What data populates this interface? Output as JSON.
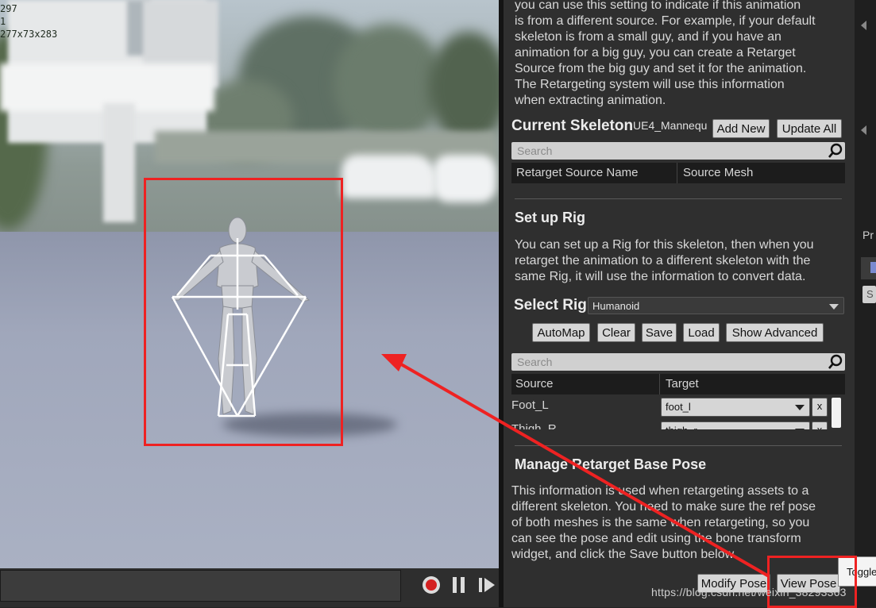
{
  "viewport": {
    "stats": [
      "297",
      "1",
      "277x73x283"
    ]
  },
  "panel": {
    "retarget_source_desc": "you can use this setting to indicate if this animation is from a different source. For example, if your default skeleton is from a small guy, and if you have an animation for a big guy, you can create a Retarget Source from the big guy and set it for the animation. The Retargeting system will use this information when extracting animation.",
    "retarget_source_lines": [
      "you can use this setting to indicate if this animation",
      "is from a different source. For example, if your default",
      "skeleton is from a small guy, and if you have an",
      "animation for a big guy, you can create a Retarget",
      "Source from the big guy and set it for the animation.",
      "The Retargeting system will use this information",
      "when extracting animation."
    ],
    "current_skeleton_label": "Current Skeleton",
    "current_skeleton_value": "UE4_Mannequ",
    "add_new_label": "Add New",
    "update_all_label": "Update All",
    "search_placeholder": "Search",
    "retarget_table_headers": [
      "Retarget Source Name",
      "Source Mesh"
    ],
    "setup_rig_title": "Set up Rig",
    "setup_rig_lines": [
      "You can set up a Rig for this skeleton, then when you",
      "retarget the animation to a different skeleton with the",
      "same Rig, it will use the information to convert data."
    ],
    "select_rig_label": "Select Rig",
    "select_rig_value": "Humanoid",
    "rig_buttons": [
      "AutoMap",
      "Clear",
      "Save",
      "Load",
      "Show Advanced"
    ],
    "mapping_headers": [
      "Source",
      "Target"
    ],
    "mapping_rows": [
      {
        "source": "Foot_L",
        "target": "foot_l",
        "remove": "x"
      },
      {
        "source": "Thigh_R",
        "target": "thigh_r",
        "remove": "x"
      }
    ],
    "base_pose_title": "Manage Retarget Base Pose",
    "base_pose_lines": [
      "This information is used when retargeting assets to a",
      "different skeleton. You need to make sure the ref pose",
      "of both meshes is the same when retargeting, so you",
      "can see the pose and edit using the bone transform",
      "widget, and click the Save button below."
    ],
    "modify_pose_label": "Modify Pose",
    "view_pose_label": "View Pose"
  },
  "strip": {
    "partial_label": "Pr",
    "partial_label2": "S"
  },
  "tooltip": "Toggle",
  "watermark": "https://blog.csdn.net/weixin_38293363",
  "colors": {
    "annotation": "#ee2222",
    "panel_bg": "#2f2f2f",
    "button_bg": "#d6d6d6",
    "record_red": "#d42020"
  },
  "icons": [
    "search-icon",
    "record-icon",
    "pause-icon",
    "play-icon",
    "combo-arrow-icon"
  ]
}
